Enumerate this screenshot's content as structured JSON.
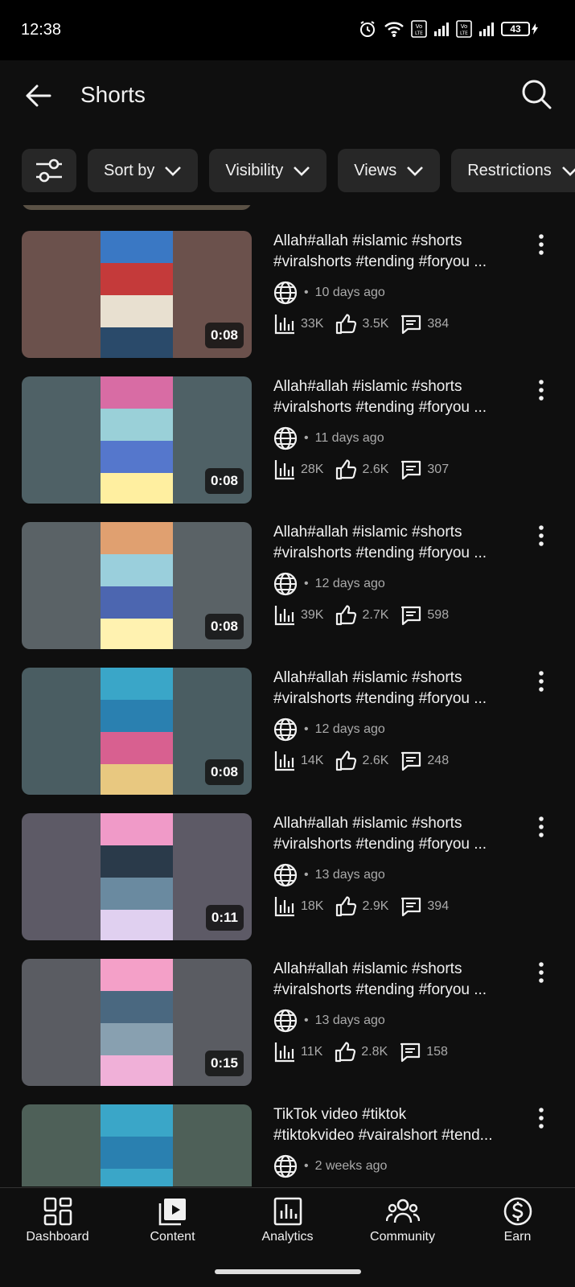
{
  "status": {
    "time": "12:38",
    "battery": "43",
    "icons": [
      "alarm-icon",
      "wifi-icon",
      "volte-icon",
      "signal-icon",
      "volte-icon",
      "signal-icon",
      "battery-icon"
    ]
  },
  "header": {
    "title": "Shorts",
    "back_icon": "back-arrow-icon",
    "search_icon": "search-icon"
  },
  "filters": {
    "icon": "filter-settings-icon",
    "chips": [
      {
        "label": "Sort by"
      },
      {
        "label": "Visibility"
      },
      {
        "label": "Views"
      },
      {
        "label": "Restrictions"
      }
    ]
  },
  "videos": [
    {
      "title1": "Allah#allah #islamic #shorts",
      "title2": "#viralshorts #tending #foryou ...",
      "age": "10 days ago",
      "views": "33K",
      "likes": "3.5K",
      "comments": "384",
      "duration": "0:08"
    },
    {
      "title1": "Allah#allah #islamic #shorts",
      "title2": "#viralshorts #tending #foryou ...",
      "age": "11 days ago",
      "views": "28K",
      "likes": "2.6K",
      "comments": "307",
      "duration": "0:08"
    },
    {
      "title1": "Allah#allah #islamic #shorts",
      "title2": "#viralshorts #tending #foryou ...",
      "age": "12 days ago",
      "views": "39K",
      "likes": "2.7K",
      "comments": "598",
      "duration": "0:08"
    },
    {
      "title1": "Allah#allah #islamic #shorts",
      "title2": "#viralshorts #tending #foryou ...",
      "age": "12 days ago",
      "views": "14K",
      "likes": "2.6K",
      "comments": "248",
      "duration": "0:08"
    },
    {
      "title1": "Allah#allah #islamic #shorts",
      "title2": "#viralshorts #tending #foryou ...",
      "age": "13 days ago",
      "views": "18K",
      "likes": "2.9K",
      "comments": "394",
      "duration": "0:11"
    },
    {
      "title1": "Allah#allah #islamic #shorts",
      "title2": "#viralshorts #tending #foryou ...",
      "age": "13 days ago",
      "views": "11K",
      "likes": "2.8K",
      "comments": "158",
      "duration": "0:15"
    },
    {
      "title1": "TikTok video #tiktok",
      "title2": "#tiktokvideo #vairalshort #tend...",
      "age": "2 weeks ago",
      "views": "",
      "likes": "",
      "comments": "",
      "duration": ""
    }
  ],
  "nav": {
    "items": [
      {
        "label": "Dashboard",
        "icon": "dashboard-icon"
      },
      {
        "label": "Content",
        "icon": "content-icon"
      },
      {
        "label": "Analytics",
        "icon": "analytics-icon"
      },
      {
        "label": "Community",
        "icon": "community-icon"
      },
      {
        "label": "Earn",
        "icon": "earn-icon"
      }
    ]
  },
  "colors": {
    "background": "#0f0f0f",
    "chip": "#272727",
    "text": "#f1f1f1",
    "muted": "#aaaaaa"
  }
}
